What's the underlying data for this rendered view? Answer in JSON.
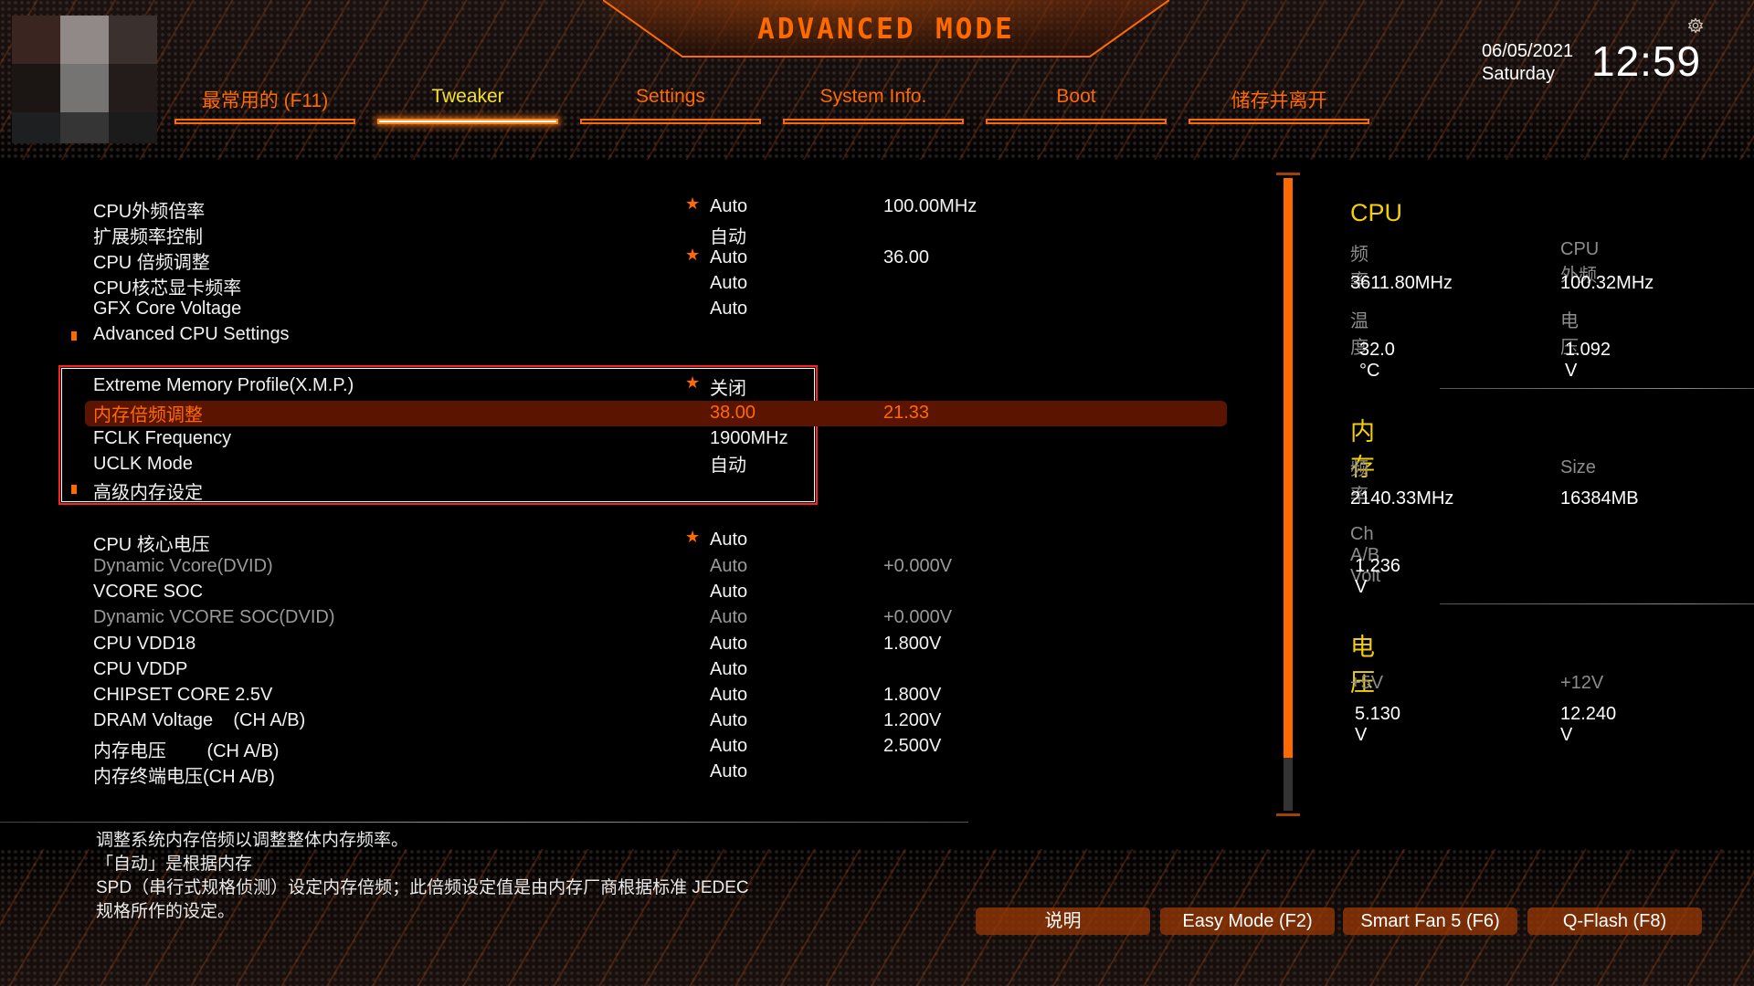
{
  "header": {
    "title": "ADVANCED MODE",
    "date": "06/05/2021",
    "weekday": "Saturday",
    "time": "12:59",
    "brand_colors": {
      "accent": "#ff6a00",
      "active_tab": "#f3e12a",
      "section_title": "#f3cf0a",
      "selected_row_bg": "#5a1400"
    }
  },
  "tabs": [
    {
      "label": "最常用的 (F11)",
      "active": false
    },
    {
      "label": "Tweaker",
      "active": true
    },
    {
      "label": "Settings",
      "active": false
    },
    {
      "label": "System Info.",
      "active": false
    },
    {
      "label": "Boot",
      "active": false
    },
    {
      "label": "储存并离开",
      "active": false
    }
  ],
  "settings": [
    {
      "label": "CPU外频倍率",
      "star": true,
      "value": "Auto",
      "value2": "100.00MHz"
    },
    {
      "label": "扩展频率控制",
      "star": false,
      "value": "自动",
      "value2": ""
    },
    {
      "label": "CPU 倍频调整",
      "star": true,
      "value": "Auto",
      "value2": "36.00"
    },
    {
      "label": "CPU核芯显卡频率",
      "star": false,
      "value": "Auto",
      "value2": ""
    },
    {
      "label": "GFX Core Voltage",
      "star": false,
      "value": "Auto",
      "value2": ""
    },
    {
      "label": "Advanced CPU Settings",
      "submenu": true
    },
    {
      "label": "Extreme Memory Profile(X.M.P.)",
      "star": true,
      "value": "关闭",
      "value2": ""
    },
    {
      "label": "内存倍频调整",
      "star": false,
      "value": "38.00",
      "value2": "21.33",
      "selected": true
    },
    {
      "label": "FCLK Frequency",
      "star": false,
      "value": "1900MHz",
      "value2": ""
    },
    {
      "label": "UCLK Mode",
      "star": false,
      "value": "自动",
      "value2": ""
    },
    {
      "label": "高级内存设定",
      "submenu": true
    },
    {
      "label": "CPU 核心电压",
      "star": true,
      "value": "Auto",
      "value2": ""
    },
    {
      "label": "Dynamic Vcore(DVID)",
      "star": false,
      "value": "Auto",
      "value2": "+0.000V",
      "dim": true
    },
    {
      "label": "VCORE SOC",
      "star": false,
      "value": "Auto",
      "value2": ""
    },
    {
      "label": "Dynamic VCORE SOC(DVID)",
      "star": false,
      "value": "Auto",
      "value2": "+0.000V",
      "dim": true
    },
    {
      "label": "CPU VDD18",
      "star": false,
      "value": "Auto",
      "value2": "1.800V"
    },
    {
      "label": "CPU VDDP",
      "star": false,
      "value": "Auto",
      "value2": ""
    },
    {
      "label": "CHIPSET CORE 2.5V",
      "star": false,
      "value": "Auto",
      "value2": "1.800V"
    },
    {
      "label": "DRAM Voltage    (CH A/B)",
      "star": false,
      "value": "Auto",
      "value2": "1.200V"
    },
    {
      "label": "内存电压        (CH A/B)",
      "star": false,
      "value": "Auto",
      "value2": "2.500V"
    },
    {
      "label": "内存终端电压(CH A/B)",
      "star": false,
      "value": "Auto",
      "value2": ""
    }
  ],
  "scrollbar": {
    "thumb_fraction": 0.916
  },
  "info_panel": {
    "cpu": {
      "title": "CPU",
      "freq_label": "频率",
      "freq_value": "3611.80MHz",
      "bclk_label": "CPU外频",
      "bclk_value": "100.32MHz",
      "temp_label": "温度",
      "temp_value": "32.0 °C",
      "volt_label": "电压",
      "volt_value": "1.092 V"
    },
    "memory": {
      "title": "内存",
      "freq_label": "频率",
      "freq_value": "2140.33MHz",
      "size_label": "Size",
      "size_value": "16384MB",
      "volt_label": "Ch A/B Volt",
      "volt_value": "1.236 V"
    },
    "voltage": {
      "title": "电压",
      "v5_label": "+5V",
      "v5_value": "5.130 V",
      "v12_label": "+12V",
      "v12_value": "12.240 V"
    }
  },
  "help_text": [
    "调整系统内存倍频以调整整体内存频率。",
    "「自动」是根据内存",
    "SPD（串行式规格侦测）设定内存倍频；此倍频设定值是由内存厂商根据标准 JEDEC",
    "规格所作的设定。"
  ],
  "bottom_buttons": [
    {
      "label": "说明"
    },
    {
      "label": "Easy Mode (F2)"
    },
    {
      "label": "Smart Fan 5 (F6)"
    },
    {
      "label": "Q-Flash (F8)"
    }
  ]
}
